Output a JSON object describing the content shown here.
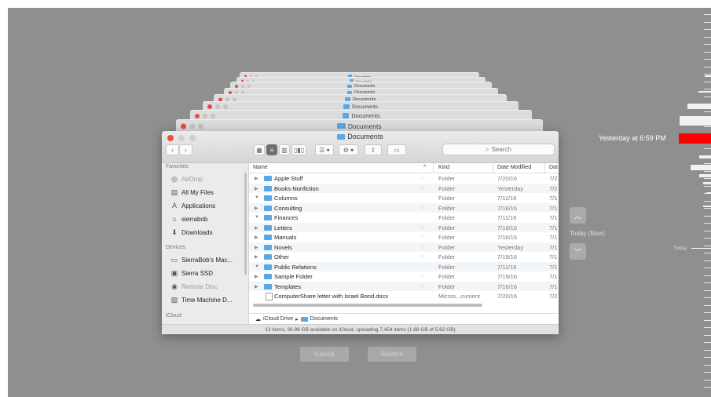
{
  "finder": {
    "title": "Documents",
    "search_placeholder": "Search",
    "back_icon": "chevron-left-icon",
    "forward_icon": "chevron-right-icon",
    "sidebar": {
      "favorites_header": "Favorites",
      "favorites": [
        {
          "label": "AirDrop",
          "icon": "airdrop-icon",
          "dim": true
        },
        {
          "label": "All My Files",
          "icon": "all-files-icon",
          "dim": false
        },
        {
          "label": "Applications",
          "icon": "applications-icon",
          "dim": false
        },
        {
          "label": "sierrabob",
          "icon": "home-icon",
          "dim": false
        },
        {
          "label": "Downloads",
          "icon": "downloads-icon",
          "dim": false
        }
      ],
      "devices_header": "Devices",
      "devices": [
        {
          "label": "SierraBob's Mac...",
          "icon": "laptop-icon",
          "dim": false
        },
        {
          "label": "Sierra SSD",
          "icon": "drive-icon",
          "dim": false
        },
        {
          "label": "Remote Disc",
          "icon": "disc-icon",
          "dim": true
        },
        {
          "label": "Time Machine D...",
          "icon": "time-machine-drive-icon",
          "dim": false
        }
      ],
      "icloud_header": "iCloud"
    },
    "columns": {
      "name": "Name",
      "sort_indicator": "^",
      "kind": "Kind",
      "date_modified": "Date Modified",
      "date_added": "Dat"
    },
    "rows": [
      {
        "name": "Apple Stuff",
        "kind": "Folder",
        "date": "7/20/16",
        "date2": "7/2",
        "expanded": false,
        "cloud": true,
        "type": "folder"
      },
      {
        "name": "Books-Nonfiction",
        "kind": "Folder",
        "date": "Yesterday",
        "date2": "7/2",
        "expanded": false,
        "cloud": true,
        "type": "folder"
      },
      {
        "name": "Columns",
        "kind": "Folder",
        "date": "7/11/16",
        "date2": "7/1",
        "expanded": true,
        "cloud": false,
        "type": "folder"
      },
      {
        "name": "Consulting",
        "kind": "Folder",
        "date": "7/16/16",
        "date2": "7/1",
        "expanded": false,
        "cloud": true,
        "type": "folder"
      },
      {
        "name": "Finances",
        "kind": "Folder",
        "date": "7/11/16",
        "date2": "7/1",
        "expanded": true,
        "cloud": false,
        "type": "folder"
      },
      {
        "name": "Letters",
        "kind": "Folder",
        "date": "7/19/16",
        "date2": "7/1",
        "expanded": false,
        "cloud": true,
        "type": "folder"
      },
      {
        "name": "Manuals",
        "kind": "Folder",
        "date": "7/16/16",
        "date2": "7/1",
        "expanded": false,
        "cloud": true,
        "type": "folder"
      },
      {
        "name": "Novels",
        "kind": "Folder",
        "date": "Yesterday",
        "date2": "7/1",
        "expanded": false,
        "cloud": true,
        "type": "folder"
      },
      {
        "name": "Other",
        "kind": "Folder",
        "date": "7/19/16",
        "date2": "7/1",
        "expanded": false,
        "cloud": true,
        "type": "folder"
      },
      {
        "name": "Public Relations",
        "kind": "Folder",
        "date": "7/11/16",
        "date2": "7/1",
        "expanded": true,
        "cloud": false,
        "type": "folder"
      },
      {
        "name": "Sample Folder",
        "kind": "Folder",
        "date": "7/19/16",
        "date2": "7/1",
        "expanded": false,
        "cloud": true,
        "type": "folder"
      },
      {
        "name": "Templates",
        "kind": "Folder",
        "date": "7/16/16",
        "date2": "7/1",
        "expanded": false,
        "cloud": true,
        "type": "folder"
      },
      {
        "name": "ComputerShare letter with Israel Bond.docx",
        "kind": "Micros...cument",
        "date": "7/20/16",
        "date2": "7/2",
        "expanded": false,
        "cloud": false,
        "type": "doc"
      }
    ],
    "path": {
      "root": "iCloud Drive",
      "separator": "▸",
      "current": "Documents"
    },
    "status": "13 items, 39.98 GB available on iCloud, uploading 7,454 items (1.88 GB of 5.62 GB)"
  },
  "stacked_windows": {
    "title": "Documents"
  },
  "time_machine": {
    "cancel_label": "Cancel",
    "restore_label": "Restore",
    "current_time_label": "Yesterday at 6:59 PM",
    "today_now_label": "Today (Now)",
    "today_label": "Today",
    "accent_color": "#ff0000"
  }
}
